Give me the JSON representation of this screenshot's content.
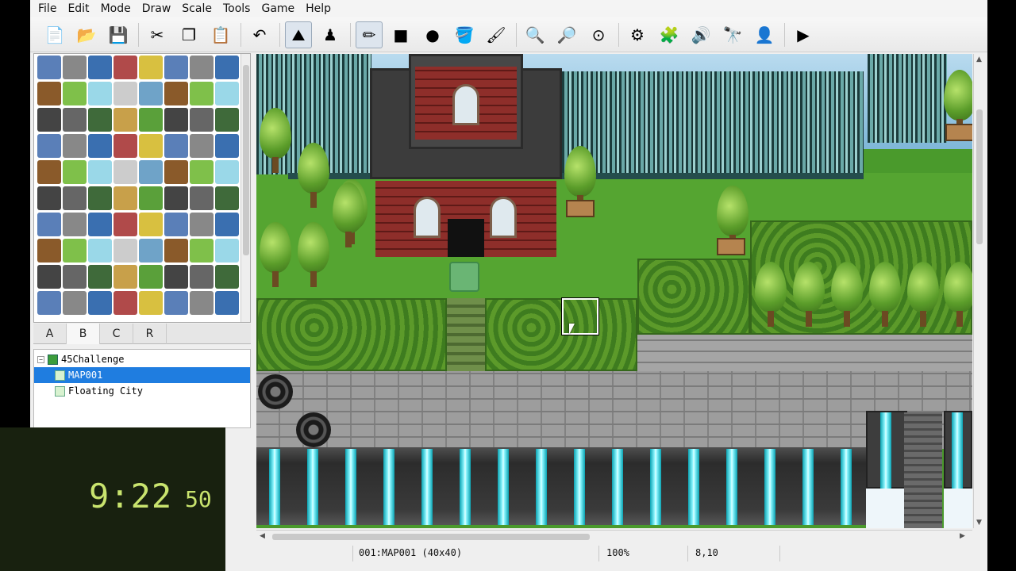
{
  "menu": [
    "File",
    "Edit",
    "Mode",
    "Draw",
    "Scale",
    "Tools",
    "Game",
    "Help"
  ],
  "toolbar": {
    "groups": [
      [
        {
          "icon": "new-project-icon",
          "glyph": "📄",
          "interactable": true
        },
        {
          "icon": "open-project-icon",
          "glyph": "📂",
          "interactable": true
        },
        {
          "icon": "save-project-icon",
          "glyph": "💾",
          "interactable": true
        }
      ],
      [
        {
          "icon": "cut-icon",
          "glyph": "✂",
          "interactable": true
        },
        {
          "icon": "copy-icon",
          "glyph": "❐",
          "interactable": true
        },
        {
          "icon": "paste-icon",
          "glyph": "📋",
          "interactable": true
        }
      ],
      [
        {
          "icon": "undo-icon",
          "glyph": "↶",
          "interactable": true
        }
      ],
      [
        {
          "icon": "map-mode-icon",
          "glyph": "⛰",
          "interactable": true,
          "active": true
        },
        {
          "icon": "event-mode-icon",
          "glyph": "♟",
          "interactable": true
        }
      ],
      [
        {
          "icon": "pencil-icon",
          "glyph": "✏",
          "interactable": true,
          "active": true
        },
        {
          "icon": "rectangle-icon",
          "glyph": "■",
          "interactable": true
        },
        {
          "icon": "ellipse-icon",
          "glyph": "●",
          "interactable": true
        },
        {
          "icon": "fill-icon",
          "glyph": "🪣",
          "interactable": true
        },
        {
          "icon": "shadow-pen-icon",
          "glyph": "🖌",
          "interactable": true
        }
      ],
      [
        {
          "icon": "zoom-in-icon",
          "glyph": "🔍",
          "interactable": true
        },
        {
          "icon": "zoom-out-icon",
          "glyph": "🔎",
          "interactable": true
        },
        {
          "icon": "actual-size-icon",
          "glyph": "⊙",
          "interactable": true
        }
      ],
      [
        {
          "icon": "database-icon",
          "glyph": "⚙",
          "interactable": true
        },
        {
          "icon": "plugin-manager-icon",
          "glyph": "🧩",
          "interactable": true
        },
        {
          "icon": "sound-test-icon",
          "glyph": "🔊",
          "interactable": true
        },
        {
          "icon": "event-searcher-icon",
          "glyph": "🔭",
          "interactable": true
        },
        {
          "icon": "character-generator-icon",
          "glyph": "👤",
          "interactable": true
        }
      ],
      [
        {
          "icon": "playtest-icon",
          "glyph": "▶",
          "interactable": true
        }
      ]
    ]
  },
  "tileset_tabs": [
    "A",
    "B",
    "C",
    "R"
  ],
  "selected_tab": "B",
  "map_tree": {
    "project": "45Challenge",
    "maps": [
      {
        "name": "MAP001",
        "selected": true
      },
      {
        "name": "Floating City",
        "selected": false
      }
    ]
  },
  "timer": {
    "main": "9:22",
    "centiseconds": "50"
  },
  "status": {
    "map": "001:MAP001 (40x40)",
    "zoom": "100%",
    "coords": "8,10"
  },
  "colors": {
    "accent": "#1f7de0",
    "timer_text": "#c9e46e",
    "grass": "#4a9a2c",
    "crystal": "#30e4f2"
  }
}
